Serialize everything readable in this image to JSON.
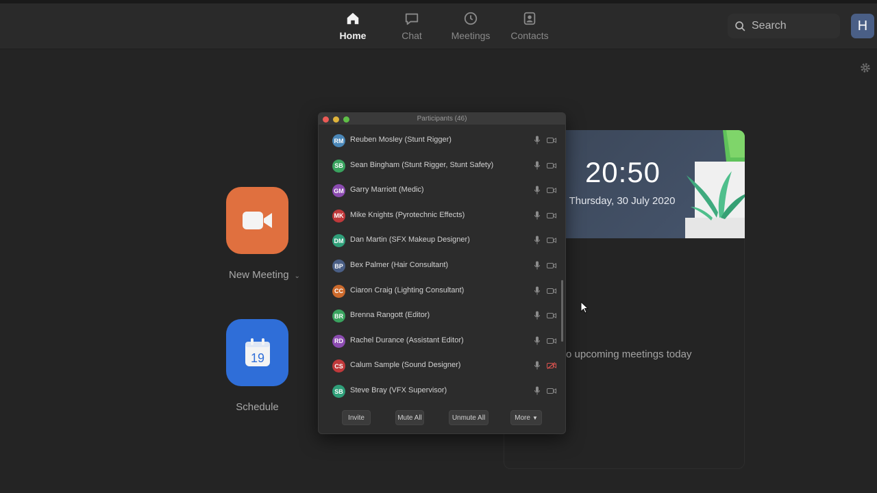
{
  "nav": {
    "home": "Home",
    "chat": "Chat",
    "meetings": "Meetings",
    "contacts": "Contacts",
    "search_placeholder": "Search",
    "avatar_initial": "H"
  },
  "actions": {
    "new_meeting": "New Meeting",
    "schedule": "Schedule",
    "calendar_day": "19"
  },
  "clock": {
    "time": "20:50",
    "date": "Thursday, 30 July 2020"
  },
  "meetings_status": "o upcoming meetings today",
  "participants": {
    "title": "Participants (46)",
    "list": [
      {
        "initials": "RM",
        "name": "Reuben Mosley (Stunt Rigger)",
        "color": "#4a87b8",
        "video_off_red": false
      },
      {
        "initials": "SB",
        "name": "Sean Bingham (Stunt Rigger, Stunt Safety)",
        "color": "#3aa35f",
        "video_off_red": false
      },
      {
        "initials": "GM",
        "name": "Garry Marriott (Medic)",
        "color": "#8b4bb0",
        "video_off_red": false
      },
      {
        "initials": "MK",
        "name": "Mike Knights (Pyrotechnic Effects)",
        "color": "#c0393b",
        "video_off_red": false
      },
      {
        "initials": "DM",
        "name": "Dan Martin (SFX Makeup Designer)",
        "color": "#2f9f79",
        "video_off_red": false
      },
      {
        "initials": "BP",
        "name": "Bex Palmer (Hair Consultant)",
        "color": "#4a5f86",
        "video_off_red": false
      },
      {
        "initials": "CC",
        "name": "Ciaron Craig (Lighting Consultant)",
        "color": "#cc6a2c",
        "video_off_red": false
      },
      {
        "initials": "BR",
        "name": "Brenna Rangott (Editor)",
        "color": "#3aa35f",
        "video_off_red": false
      },
      {
        "initials": "RD",
        "name": "Rachel Durance (Assistant Editor)",
        "color": "#8b4bb0",
        "video_off_red": false
      },
      {
        "initials": "CS",
        "name": "Calum Sample (Sound Designer)",
        "color": "#c0393b",
        "video_off_red": true
      },
      {
        "initials": "SB",
        "name": "Steve Bray (VFX Supervisor)",
        "color": "#2f9f79",
        "video_off_red": false
      }
    ],
    "buttons": {
      "invite": "Invite",
      "mute_all": "Mute All",
      "unmute_all": "Unmute All",
      "more": "More"
    }
  }
}
